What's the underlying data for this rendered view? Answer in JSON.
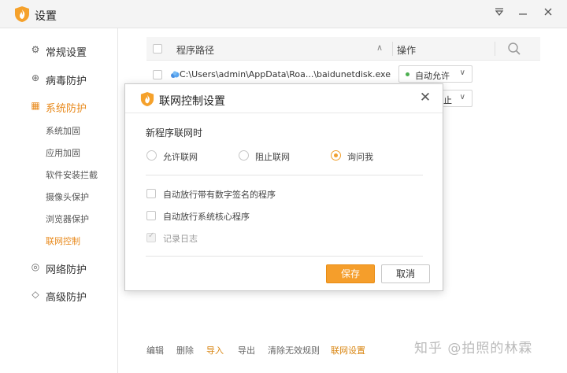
{
  "window": {
    "title": "设置"
  },
  "sidebar": {
    "items": [
      {
        "label": "常规设置",
        "icon": "gear-icon"
      },
      {
        "label": "病毒防护",
        "icon": "plus-square-icon"
      },
      {
        "label": "系统防护",
        "icon": "grid-icon"
      },
      {
        "label": "网络防护",
        "icon": "globe-icon"
      },
      {
        "label": "高级防护",
        "icon": "diamond-icon"
      }
    ],
    "subitems": [
      {
        "label": "系统加固"
      },
      {
        "label": "应用加固"
      },
      {
        "label": "软件安装拦截"
      },
      {
        "label": "摄像头保护"
      },
      {
        "label": "浏览器保护"
      },
      {
        "label": "联网控制"
      }
    ]
  },
  "table": {
    "col_path": "程序路径",
    "col_action": "操作",
    "rows": [
      {
        "path": "C:\\Users\\admin\\AppData\\Roa...\\baidunetdisk.exe",
        "action": "自动允许"
      },
      {
        "action": "止"
      }
    ]
  },
  "footer": {
    "edit": "编辑",
    "delete": "删除",
    "import": "导入",
    "export": "导出",
    "clear": "清除无效规则",
    "network": "联网设置"
  },
  "watermark": "知乎 @拍照的林霖",
  "modal": {
    "title": "联网控制设置",
    "section": "新程序联网时",
    "radios": [
      {
        "label": "允许联网",
        "selected": false
      },
      {
        "label": "阻止联网",
        "selected": false
      },
      {
        "label": "询问我",
        "selected": true
      }
    ],
    "checks": [
      {
        "label": "自动放行带有数字签名的程序",
        "checked": false,
        "disabled": false
      },
      {
        "label": "自动放行系统核心程序",
        "checked": false,
        "disabled": false
      },
      {
        "label": "记录日志",
        "checked": true,
        "disabled": true
      }
    ],
    "save": "保存",
    "cancel": "取消"
  },
  "colors": {
    "accent": "#f59e2b",
    "active_nav": "#e8891b"
  }
}
